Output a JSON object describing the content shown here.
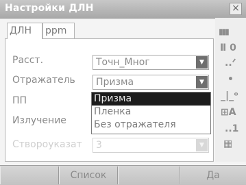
{
  "window": {
    "title": "Настройки ДЛН",
    "close_icon": "close-icon"
  },
  "tabs": [
    {
      "label": "ДЛН",
      "active": true
    },
    {
      "label": "ppm",
      "active": false
    }
  ],
  "form": {
    "rows": [
      {
        "label": "Расст.",
        "value": "Точн_Мног",
        "enabled": true,
        "has_dropdown": true
      },
      {
        "label": "Отражатель",
        "value": "Призма",
        "enabled": true,
        "has_dropdown": true
      },
      {
        "label": "ПП",
        "value": "",
        "enabled": true,
        "has_dropdown": false
      },
      {
        "label": "Излучение",
        "value": "",
        "enabled": true,
        "has_dropdown": false
      },
      {
        "label": "Створоуказат",
        "value": "3",
        "enabled": false,
        "has_dropdown": true
      }
    ]
  },
  "dropdown": {
    "items": [
      "Призма",
      "Пленка",
      "Без отражателя"
    ],
    "selected_index": 0
  },
  "sidebar": {
    "icons": [
      {
        "name": "battery-icon",
        "glyph": "▮▮▮"
      },
      {
        "name": "target-zero-icon",
        "glyph": "Ⅱ 0"
      },
      {
        "name": "tilt-icon",
        "glyph": "..ᐟ"
      },
      {
        "name": "dot-icon",
        "glyph": "•"
      },
      {
        "name": "prism-target-icon",
        "glyph": "_|_ᵒ"
      },
      {
        "name": "input-mode-icon",
        "glyph": "⊞A"
      },
      {
        "name": "page-indicator-icon",
        "glyph": "..1"
      },
      {
        "name": "keyboard-icon",
        "glyph": "▦"
      }
    ]
  },
  "softkeys": [
    {
      "label": ""
    },
    {
      "label": "Список"
    },
    {
      "label": ""
    },
    {
      "label": "Да"
    }
  ]
}
